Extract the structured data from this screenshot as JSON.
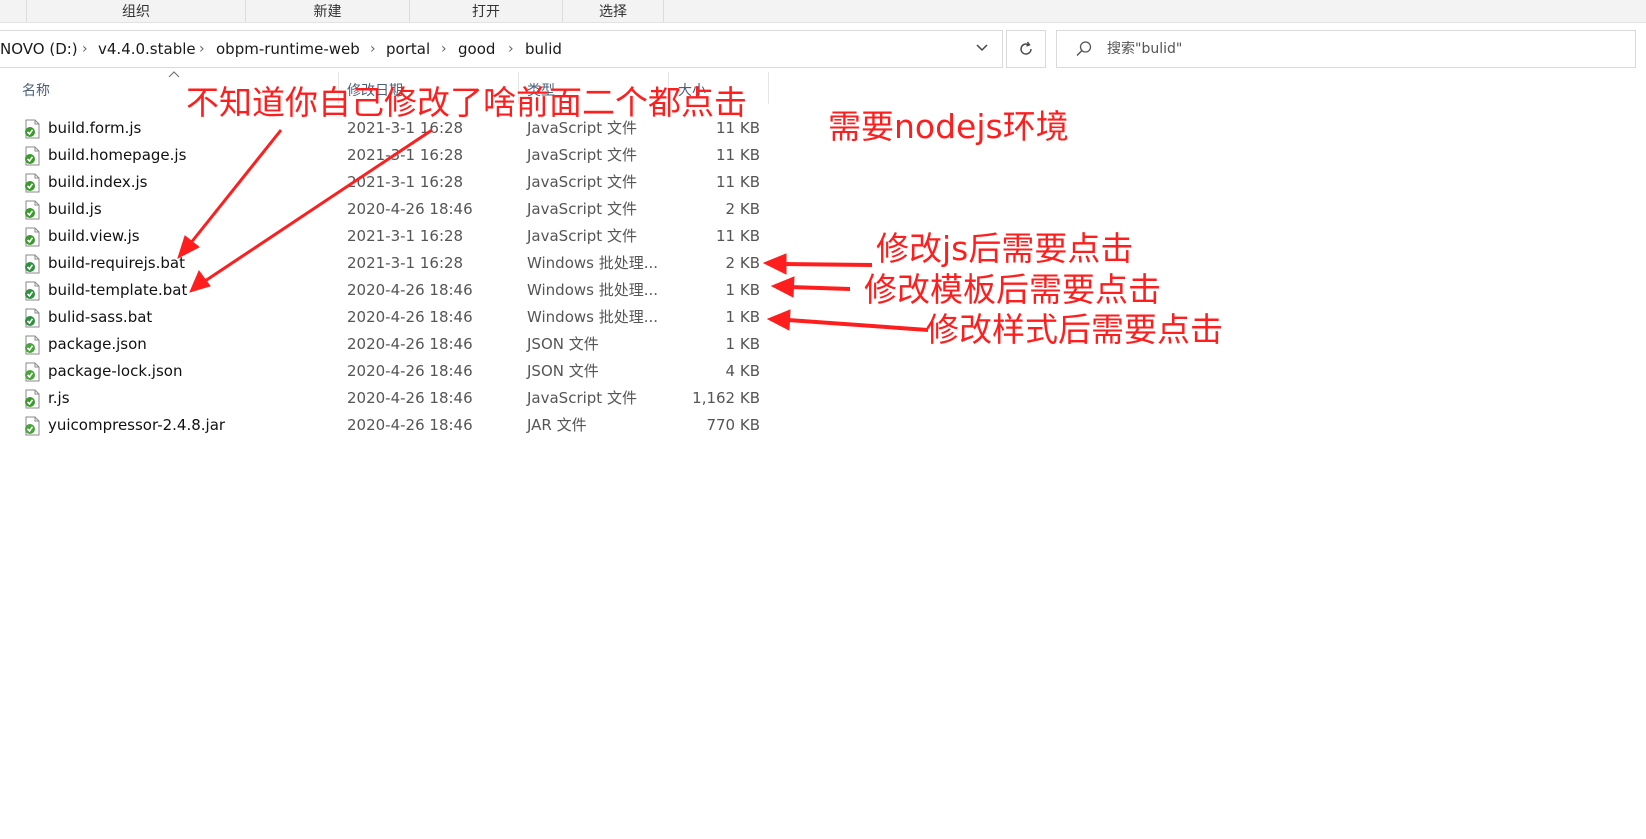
{
  "ribbon": {
    "groups": [
      "组织",
      "新建",
      "打开",
      "选择"
    ]
  },
  "address": {
    "crumbs": [
      "NOVO (D:)",
      "v4.4.0.stable",
      "obpm-runtime-web",
      "portal",
      "good",
      "bulid"
    ],
    "separator": "›"
  },
  "search": {
    "placeholder": "搜索\"bulid\""
  },
  "columns": {
    "name": "名称",
    "date": "修改日期",
    "type": "类型",
    "size": "大小"
  },
  "files": [
    {
      "name": "build.form.js",
      "date": "2021-3-1 16:28",
      "type": "JavaScript 文件",
      "size": "11 KB",
      "icon": "js-file-icon"
    },
    {
      "name": "build.homepage.js",
      "date": "2021-3-1 16:28",
      "type": "JavaScript 文件",
      "size": "11 KB",
      "icon": "js-file-icon"
    },
    {
      "name": "build.index.js",
      "date": "2021-3-1 16:28",
      "type": "JavaScript 文件",
      "size": "11 KB",
      "icon": "js-file-icon"
    },
    {
      "name": "build.js",
      "date": "2020-4-26 18:46",
      "type": "JavaScript 文件",
      "size": "2 KB",
      "icon": "js-file-icon"
    },
    {
      "name": "build.view.js",
      "date": "2021-3-1 16:28",
      "type": "JavaScript 文件",
      "size": "11 KB",
      "icon": "js-file-icon"
    },
    {
      "name": "build-requirejs.bat",
      "date": "2021-3-1 16:28",
      "type": "Windows 批处理...",
      "size": "2 KB",
      "icon": "bat-file-icon"
    },
    {
      "name": "build-template.bat",
      "date": "2020-4-26 18:46",
      "type": "Windows 批处理...",
      "size": "1 KB",
      "icon": "bat-file-icon"
    },
    {
      "name": "bulid-sass.bat",
      "date": "2020-4-26 18:46",
      "type": "Windows 批处理...",
      "size": "1 KB",
      "icon": "bat-file-icon"
    },
    {
      "name": "package.json",
      "date": "2020-4-26 18:46",
      "type": "JSON 文件",
      "size": "1 KB",
      "icon": "json-file-icon"
    },
    {
      "name": "package-lock.json",
      "date": "2020-4-26 18:46",
      "type": "JSON 文件",
      "size": "4 KB",
      "icon": "json-file-icon"
    },
    {
      "name": "r.js",
      "date": "2020-4-26 18:46",
      "type": "JavaScript 文件",
      "size": "1,162 KB",
      "icon": "js-file-icon"
    },
    {
      "name": "yuicompressor-2.4.8.jar",
      "date": "2020-4-26 18:46",
      "type": "JAR 文件",
      "size": "770 KB",
      "icon": "jar-file-icon"
    }
  ],
  "annotations": {
    "top_note": "不知道你自己修改了啥前面二个都点击",
    "env_note": "需要nodejs环境",
    "js_note": "修改js后需要点击",
    "template_note": "修改模板后需要点击",
    "style_note": "修改样式后需要点击",
    "color": "#ff1e1e"
  }
}
